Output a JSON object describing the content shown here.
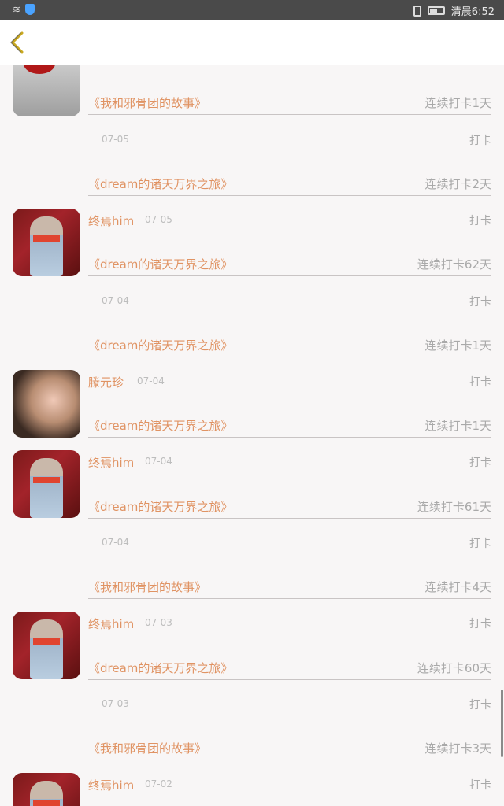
{
  "status": {
    "time": "清晨6:52"
  },
  "header": {
    "back_label": ""
  },
  "entries": [
    {
      "book": "《我和邪骨团的故事》",
      "streak": "连续打卡1天",
      "date": "07-05",
      "name": "",
      "checkin": "打卡"
    },
    {
      "book": "《dream的诸天万界之旅》",
      "streak": "连续打卡2天",
      "name": "终焉him",
      "date": "07-05",
      "checkin": "打卡"
    },
    {
      "book": "《dream的诸天万界之旅》",
      "streak": "连续打卡62天",
      "name": "",
      "date": "07-04",
      "checkin": "打卡"
    },
    {
      "book": "《dream的诸天万界之旅》",
      "streak": "连续打卡1天",
      "name": "滕元珍",
      "date": "07-04",
      "checkin": "打卡"
    },
    {
      "book": "《dream的诸天万界之旅》",
      "streak": "连续打卡1天",
      "name": "终焉him",
      "date": "07-04",
      "checkin": "打卡"
    },
    {
      "book": "《dream的诸天万界之旅》",
      "streak": "连续打卡61天",
      "name": "",
      "date": "07-04",
      "checkin": "打卡"
    },
    {
      "book": "《我和邪骨团的故事》",
      "streak": "连续打卡4天",
      "name": "终焉him",
      "date": "07-03",
      "checkin": "打卡"
    },
    {
      "book": "《dream的诸天万界之旅》",
      "streak": "连续打卡60天",
      "name": "",
      "date": "07-03",
      "checkin": "打卡"
    },
    {
      "book": "《我和邪骨团的故事》",
      "streak": "连续打卡3天",
      "name": "终焉him",
      "date": "07-02",
      "checkin": "打卡"
    }
  ]
}
